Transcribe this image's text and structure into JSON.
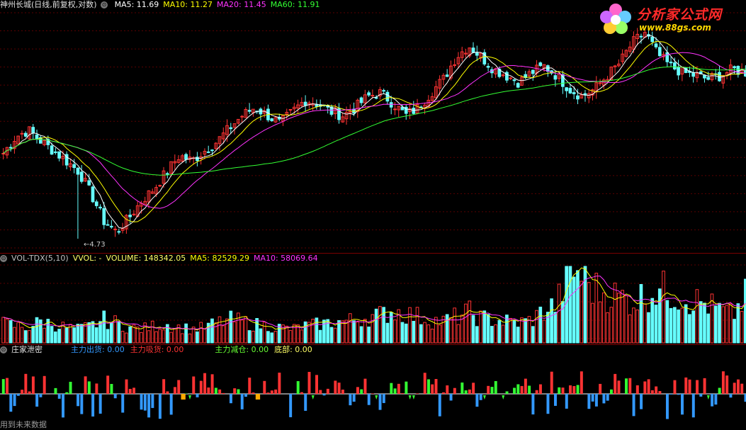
{
  "header_price": {
    "title": "神州长城(日线,前复权,对数)",
    "items": [
      {
        "label": "MA5: 11.69",
        "color": "#ffffff"
      },
      {
        "label": "MA10: 11.27",
        "color": "#ffff00"
      },
      {
        "label": "MA20: 11.45",
        "color": "#ff33ff"
      },
      {
        "label": "MA60: 11.91",
        "color": "#33ff33"
      }
    ]
  },
  "header_vol": {
    "items": [
      {
        "label": "VOL-TDX(5,10)",
        "color": "#c0c0c0"
      },
      {
        "label": "VVOL: -",
        "color": "#ffff66"
      },
      {
        "label": "VOLUME: 148342.05",
        "color": "#ffff66"
      },
      {
        "label": "MA5: 82529.29",
        "color": "#ffff00"
      },
      {
        "label": "MA10: 58069.64",
        "color": "#ff33ff"
      }
    ]
  },
  "header_ind": {
    "title": "庄家泄密",
    "items": [
      {
        "label": "主力出货: 0.00",
        "color": "#3399ff"
      },
      {
        "label": "主力吸货: 0.00",
        "color": "#ff3333"
      },
      {
        "label": "主力减仓: 0.00",
        "color": "#66ff33"
      },
      {
        "label": "底部: 0.00",
        "color": "#ffff66"
      }
    ]
  },
  "logo": {
    "text": "分析家公式网",
    "url": "www.88gs.com"
  },
  "low_label": "4.73",
  "footer_note": "用到未来数据",
  "colors": {
    "up": "#ff3333",
    "down": "#66ffff",
    "ma5": "#ffffff",
    "ma10": "#ffff00",
    "ma20": "#ff33ff",
    "ma60": "#33ff33"
  },
  "chart_data": [
    {
      "type": "candlestick",
      "title": "神州长城(日线,前复权,对数)",
      "scale": "log",
      "ylim": [
        4.5,
        16
      ],
      "n_bars": 200,
      "close_approx": [
        7.5,
        8.2,
        8.5,
        8.0,
        7.6,
        7.2,
        6.8,
        6.0,
        5.2,
        4.9,
        5.3,
        5.8,
        6.2,
        6.8,
        7.4,
        7.2,
        7.6,
        8.0,
        8.6,
        9.2,
        9.6,
        9.2,
        8.8,
        9.4,
        10.0,
        9.8,
        9.4,
        9.2,
        9.6,
        10.2,
        10.4,
        9.8,
        9.2,
        9.6,
        10.4,
        11.2,
        12.6,
        13.4,
        12.6,
        11.8,
        11.4,
        11.0,
        11.6,
        12.0,
        11.4,
        10.6,
        10.2,
        10.6,
        11.4,
        12.2,
        13.6,
        14.4,
        12.8,
        12.0,
        11.6,
        11.4,
        11.2,
        11.4,
        11.8,
        11.6
      ],
      "annotation": {
        "label": "4.73",
        "type": "low"
      },
      "series_ma": [
        {
          "name": "MA5",
          "last": 11.69
        },
        {
          "name": "MA10",
          "last": 11.27
        },
        {
          "name": "MA20",
          "last": 11.45
        },
        {
          "name": "MA60",
          "last": 11.91
        }
      ]
    },
    {
      "type": "bar",
      "title": "VOL-TDX(5,10)",
      "last": {
        "VOLUME": 148342.05,
        "MA5": 82529.29,
        "MA10": 58069.64
      },
      "volume_rel": [
        0.25,
        0.22,
        0.2,
        0.28,
        0.24,
        0.2,
        0.18,
        0.22,
        0.3,
        0.26,
        0.2,
        0.18,
        0.22,
        0.24,
        0.2,
        0.18,
        0.2,
        0.26,
        0.3,
        0.28,
        0.24,
        0.22,
        0.2,
        0.18,
        0.22,
        0.24,
        0.26,
        0.28,
        0.3,
        0.34,
        0.36,
        0.42,
        0.38,
        0.34,
        0.3,
        0.28,
        0.34,
        0.4,
        0.32,
        0.3,
        0.28,
        0.26,
        0.3,
        0.42,
        0.5,
        0.95,
        0.9,
        0.7,
        0.65,
        0.6,
        0.55,
        0.62,
        0.7,
        0.66,
        0.6,
        0.55,
        0.5,
        0.42,
        0.36,
        0.6
      ]
    },
    {
      "type": "bar",
      "title": "庄家泄密",
      "series": [
        {
          "name": "主力出货",
          "value": 0.0
        },
        {
          "name": "主力吸货",
          "value": 0.0
        },
        {
          "name": "主力减仓",
          "value": 0.0
        },
        {
          "name": "底部",
          "value": 0.0
        }
      ]
    }
  ]
}
